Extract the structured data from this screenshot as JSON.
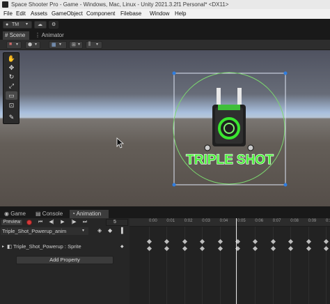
{
  "window": {
    "title": "Space Shooter Pro - Game - Windows, Mac, Linux - Unity 2021.3.2f1 Personal* <DX11>"
  },
  "menu": {
    "items": [
      "File",
      "Edit",
      "Assets",
      "GameObject",
      "Component",
      "Filebase",
      "Window",
      "Help"
    ]
  },
  "toolbar": {
    "account_label": "TM"
  },
  "scene_tabs": {
    "tabs": [
      "Scene",
      "Animator"
    ],
    "active": "Scene"
  },
  "scene": {
    "powerup_text": "TRIPLE SHOT"
  },
  "bottom_tabs": {
    "tabs": [
      "Game",
      "Console",
      "Animation"
    ],
    "active": "Animation"
  },
  "animation": {
    "preview_label": "Preview",
    "current_frame": "5",
    "clip_name": "Triple_Shot_Powerup_anim",
    "property_label": "Triple_Shot_Powerup : Sprite",
    "add_property_label": "Add Property",
    "ruler_labels": [
      "0:00",
      "0:01",
      "0:02",
      "0:03",
      "0:04",
      "0:05",
      "0:06",
      "0:07",
      "0:08",
      "0:09",
      "0:1"
    ]
  }
}
